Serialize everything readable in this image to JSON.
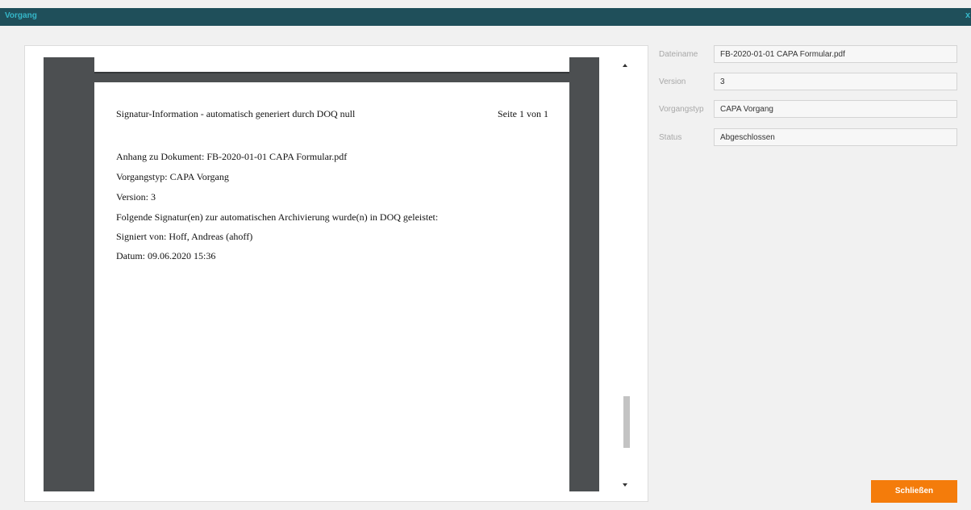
{
  "window": {
    "title": "Vorgang",
    "close_glyph": "x"
  },
  "document": {
    "header": "Signatur-Information - automatisch generiert durch DOQ null",
    "page_number": "Seite 1 von 1",
    "lines": [
      "Anhang zu Dokument: FB-2020-01-01 CAPA Formular.pdf",
      "Vorgangstyp: CAPA Vorgang",
      "Version: 3",
      "Folgende Signatur(en) zur automatischen Archivierung wurde(n) in DOQ geleistet:",
      "Signiert von: Hoff, Andreas (ahoff)",
      "Datum: 09.06.2020 15:36"
    ]
  },
  "fields": [
    {
      "label": "Dateiname",
      "value": "FB-2020-01-01 CAPA Formular.pdf"
    },
    {
      "label": "Version",
      "value": "3"
    },
    {
      "label": "Vorgangstyp",
      "value": "CAPA Vorgang"
    },
    {
      "label": "Status",
      "value": "Abgeschlossen"
    }
  ],
  "buttons": {
    "close_label": "Schließen"
  },
  "colors": {
    "titlebar": "#1f4f5a",
    "title_text": "#35b7c9",
    "accent_button": "#f47c0b"
  }
}
